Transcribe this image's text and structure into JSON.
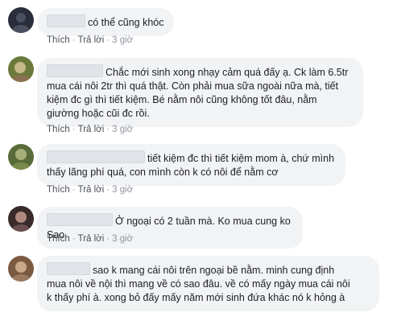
{
  "actions": {
    "like": "Thích",
    "reply": "Trả lời",
    "separator": "·"
  },
  "comments": [
    {
      "text": "có thể cũng khóc",
      "time": "3 giờ",
      "avatar_colors": [
        "#2a2d3a",
        "#4b4f60"
      ]
    },
    {
      "lines": [
        "Chắc mới sinh xong nhạy cảm quá đấy ạ. Ck làm 6.5tr",
        "mua cái nôi 2tr thì quá thật. Còn phải mua sữa ngoài nữa mà, tiết",
        "kiệm đc gì thì tiết kiệm. Bé nằm nôi cũng không tốt đâu, nằm",
        "giường hoặc cũi đc rồi."
      ],
      "time": "3 giờ",
      "avatar_colors": [
        "#6b7a3a",
        "#c9b98a"
      ]
    },
    {
      "lines": [
        "tiết kiệm đc thì tiết kiệm mom à, chứ mình",
        "thấy lãng phí quá, con mình còn k có nôi để nằm cơ"
      ],
      "time": "3 giờ",
      "avatar_colors": [
        "#5a6b3a",
        "#a8b07a"
      ]
    },
    {
      "text": "Ở ngoại có 2 tuần mà. Ko mua cung ko Sao",
      "time": "3 giờ",
      "avatar_colors": [
        "#3a2a2a",
        "#b08a80"
      ]
    },
    {
      "lines": [
        "sao k mang cái nôi trên ngoại bề nằm. minh cung định",
        "mua nôi về nội thì mang về có sao đâu. về có mấy ngày mua cái nôi",
        "k thấy phí à. xong bỏ đấy mấy năm mới sinh đứa khác nó k hỏng à"
      ],
      "time": "3 giờ",
      "avatar_colors": [
        "#7a5a40",
        "#c8a888"
      ]
    }
  ]
}
